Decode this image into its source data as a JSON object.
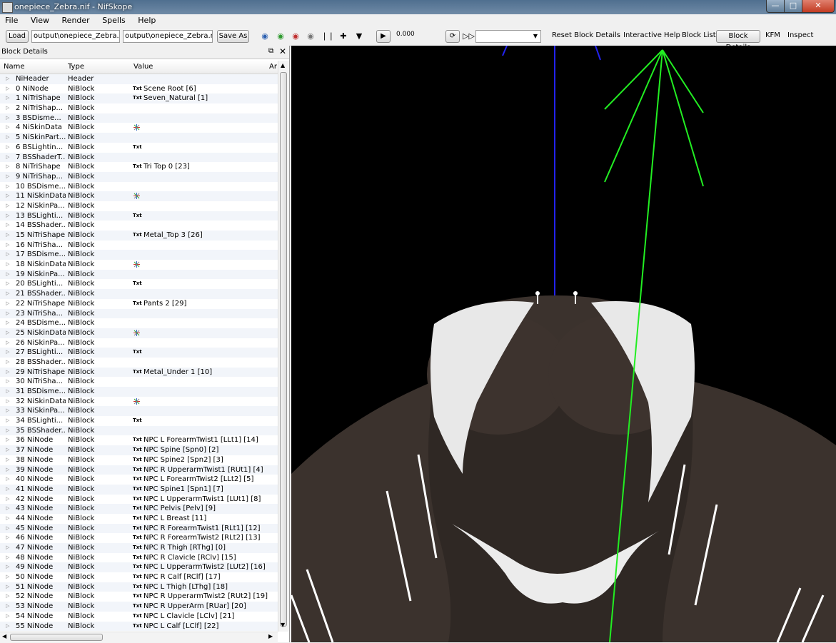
{
  "window": {
    "title": "onepiece_Zebra.nif - NifSkope"
  },
  "menu": [
    "File",
    "View",
    "Render",
    "Spells",
    "Help"
  ],
  "toolbar": {
    "load_label": "Load",
    "load_path": "output\\onepiece_Zebra.nif",
    "save_path": "output\\onepiece_Zebra.nif",
    "save_as_label": "Save As",
    "time_value": "0.000",
    "reset_block_details": "Reset Block Details",
    "interactive_help": "Interactive Help",
    "block_list": "Block List",
    "block_details": "Block Details",
    "kfm": "KFM",
    "inspect": "Inspect"
  },
  "panel": {
    "title": "Block Details",
    "columns": [
      "Name",
      "Type",
      "Value",
      "Ar"
    ],
    "rows": [
      {
        "name": "NiHeader",
        "type": "Header",
        "value": "",
        "icon": "none"
      },
      {
        "name": "0 NiNode",
        "type": "NiBlock",
        "value": "Scene Root [6]",
        "icon": "txt"
      },
      {
        "name": "1 NiTriShape",
        "type": "NiBlock",
        "value": "Seven_Natural [1]",
        "icon": "txt"
      },
      {
        "name": "2 NiTriShap...",
        "type": "NiBlock",
        "value": "",
        "icon": "none"
      },
      {
        "name": "3 BSDisme...",
        "type": "NiBlock",
        "value": "",
        "icon": "none"
      },
      {
        "name": "4 NiSkinData",
        "type": "NiBlock",
        "value": "",
        "icon": "axis"
      },
      {
        "name": "5 NiSkinPart...",
        "type": "NiBlock",
        "value": "",
        "icon": "none"
      },
      {
        "name": "6 BSLightin...",
        "type": "NiBlock",
        "value": "",
        "icon": "txt"
      },
      {
        "name": "7 BSShaderT...",
        "type": "NiBlock",
        "value": "",
        "icon": "none"
      },
      {
        "name": "8 NiTriShape",
        "type": "NiBlock",
        "value": "Tri Top 0 [23]",
        "icon": "txt"
      },
      {
        "name": "9 NiTriShap...",
        "type": "NiBlock",
        "value": "",
        "icon": "none"
      },
      {
        "name": "10 BSDisme...",
        "type": "NiBlock",
        "value": "",
        "icon": "none"
      },
      {
        "name": "11 NiSkinData",
        "type": "NiBlock",
        "value": "",
        "icon": "axis"
      },
      {
        "name": "12 NiSkinPa...",
        "type": "NiBlock",
        "value": "",
        "icon": "none"
      },
      {
        "name": "13 BSLighti...",
        "type": "NiBlock",
        "value": "",
        "icon": "txt"
      },
      {
        "name": "14 BSShader...",
        "type": "NiBlock",
        "value": "",
        "icon": "none"
      },
      {
        "name": "15 NiTriShape",
        "type": "NiBlock",
        "value": "Metal_Top 3 [26]",
        "icon": "txt"
      },
      {
        "name": "16 NiTriSha...",
        "type": "NiBlock",
        "value": "",
        "icon": "none"
      },
      {
        "name": "17 BSDisme...",
        "type": "NiBlock",
        "value": "",
        "icon": "none"
      },
      {
        "name": "18 NiSkinData",
        "type": "NiBlock",
        "value": "",
        "icon": "axis"
      },
      {
        "name": "19 NiSkinPa...",
        "type": "NiBlock",
        "value": "",
        "icon": "none"
      },
      {
        "name": "20 BSLighti...",
        "type": "NiBlock",
        "value": "",
        "icon": "txt"
      },
      {
        "name": "21 BSShader...",
        "type": "NiBlock",
        "value": "",
        "icon": "none"
      },
      {
        "name": "22 NiTriShape",
        "type": "NiBlock",
        "value": "Pants 2 [29]",
        "icon": "txt"
      },
      {
        "name": "23 NiTriSha...",
        "type": "NiBlock",
        "value": "",
        "icon": "none"
      },
      {
        "name": "24 BSDisme...",
        "type": "NiBlock",
        "value": "",
        "icon": "none"
      },
      {
        "name": "25 NiSkinData",
        "type": "NiBlock",
        "value": "",
        "icon": "axis"
      },
      {
        "name": "26 NiSkinPa...",
        "type": "NiBlock",
        "value": "",
        "icon": "none"
      },
      {
        "name": "27 BSLighti...",
        "type": "NiBlock",
        "value": "",
        "icon": "txt"
      },
      {
        "name": "28 BSShader...",
        "type": "NiBlock",
        "value": "",
        "icon": "none"
      },
      {
        "name": "29 NiTriShape",
        "type": "NiBlock",
        "value": "Metal_Under 1 [10]",
        "icon": "txt"
      },
      {
        "name": "30 NiTriSha...",
        "type": "NiBlock",
        "value": "",
        "icon": "none"
      },
      {
        "name": "31 BSDisme...",
        "type": "NiBlock",
        "value": "",
        "icon": "none"
      },
      {
        "name": "32 NiSkinData",
        "type": "NiBlock",
        "value": "",
        "icon": "axis"
      },
      {
        "name": "33 NiSkinPa...",
        "type": "NiBlock",
        "value": "",
        "icon": "none"
      },
      {
        "name": "34 BSLighti...",
        "type": "NiBlock",
        "value": "",
        "icon": "txt"
      },
      {
        "name": "35 BSShader...",
        "type": "NiBlock",
        "value": "",
        "icon": "none"
      },
      {
        "name": "36 NiNode",
        "type": "NiBlock",
        "value": "NPC L ForearmTwist1 [LLt1] [14]",
        "icon": "txt"
      },
      {
        "name": "37 NiNode",
        "type": "NiBlock",
        "value": "NPC Spine [Spn0] [2]",
        "icon": "txt"
      },
      {
        "name": "38 NiNode",
        "type": "NiBlock",
        "value": "NPC Spine2 [Spn2] [3]",
        "icon": "txt"
      },
      {
        "name": "39 NiNode",
        "type": "NiBlock",
        "value": "NPC R UpperarmTwist1 [RUt1] [4]",
        "icon": "txt"
      },
      {
        "name": "40 NiNode",
        "type": "NiBlock",
        "value": "NPC L ForearmTwist2 [LLt2] [5]",
        "icon": "txt"
      },
      {
        "name": "41 NiNode",
        "type": "NiBlock",
        "value": "NPC Spine1 [Spn1] [7]",
        "icon": "txt"
      },
      {
        "name": "42 NiNode",
        "type": "NiBlock",
        "value": "NPC L UpperarmTwist1 [LUt1] [8]",
        "icon": "txt"
      },
      {
        "name": "43 NiNode",
        "type": "NiBlock",
        "value": "NPC Pelvis [Pelv] [9]",
        "icon": "txt"
      },
      {
        "name": "44 NiNode",
        "type": "NiBlock",
        "value": "NPC L Breast [11]",
        "icon": "txt"
      },
      {
        "name": "45 NiNode",
        "type": "NiBlock",
        "value": "NPC R ForearmTwist1 [RLt1] [12]",
        "icon": "txt"
      },
      {
        "name": "46 NiNode",
        "type": "NiBlock",
        "value": "NPC R ForearmTwist2 [RLt2] [13]",
        "icon": "txt"
      },
      {
        "name": "47 NiNode",
        "type": "NiBlock",
        "value": "NPC R Thigh [RThg] [0]",
        "icon": "txt"
      },
      {
        "name": "48 NiNode",
        "type": "NiBlock",
        "value": "NPC R Clavicle [RClv] [15]",
        "icon": "txt"
      },
      {
        "name": "49 NiNode",
        "type": "NiBlock",
        "value": "NPC L UpperarmTwist2 [LUt2] [16]",
        "icon": "txt"
      },
      {
        "name": "50 NiNode",
        "type": "NiBlock",
        "value": "NPC R Calf [RClf] [17]",
        "icon": "txt"
      },
      {
        "name": "51 NiNode",
        "type": "NiBlock",
        "value": "NPC L Thigh [LThg] [18]",
        "icon": "txt"
      },
      {
        "name": "52 NiNode",
        "type": "NiBlock",
        "value": "NPC R UpperarmTwist2 [RUt2] [19]",
        "icon": "txt"
      },
      {
        "name": "53 NiNode",
        "type": "NiBlock",
        "value": "NPC R UpperArm [RUar] [20]",
        "icon": "txt"
      },
      {
        "name": "54 NiNode",
        "type": "NiBlock",
        "value": "NPC L Clavicle [LClv] [21]",
        "icon": "txt"
      },
      {
        "name": "55 NiNode",
        "type": "NiBlock",
        "value": "NPC L Calf [LClf] [22]",
        "icon": "txt"
      }
    ]
  },
  "labels": {
    "txt": "Txt"
  },
  "colors": {
    "accent_green": "#22ee22",
    "axis_blue": "#2222ee",
    "skin": "#3b322d",
    "cloth": "#e8e8e8"
  }
}
